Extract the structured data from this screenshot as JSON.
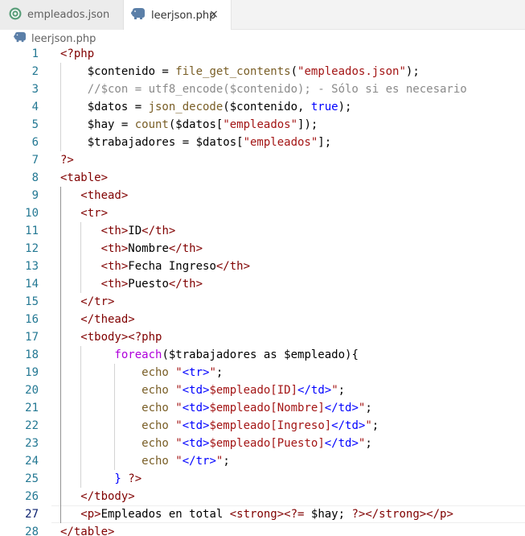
{
  "tabs": [
    {
      "label": "empleados.json",
      "icon": "json-file-icon",
      "active": false
    },
    {
      "label": "leerjson.php",
      "icon": "php-elephant-icon",
      "active": true,
      "close": "×"
    }
  ],
  "breadcrumb": {
    "label": "leerjson.php",
    "icon": "php-elephant-icon"
  },
  "editor": {
    "current_line": 27,
    "lines": [
      {
        "n": "1",
        "tokens": [
          [
            "t-php",
            "<?php"
          ]
        ]
      },
      {
        "n": "2",
        "tokens": [
          [
            "t-txt",
            "    $contenido = "
          ],
          [
            "t-fn",
            "file_get_contents"
          ],
          [
            "t-txt",
            "("
          ],
          [
            "t-str",
            "\"empleados.json\""
          ],
          [
            "t-txt",
            ");"
          ]
        ]
      },
      {
        "n": "3",
        "tokens": [
          [
            "t-cm",
            "    //$con = utf8_encode($contenido); - Sólo si es necesario"
          ]
        ]
      },
      {
        "n": "4",
        "tokens": [
          [
            "t-txt",
            "    $datos = "
          ],
          [
            "t-fn",
            "json_decode"
          ],
          [
            "t-txt",
            "($contenido, "
          ],
          [
            "t-kw",
            "true"
          ],
          [
            "t-txt",
            ");"
          ]
        ]
      },
      {
        "n": "5",
        "tokens": [
          [
            "t-txt",
            "    $hay = "
          ],
          [
            "t-fn",
            "count"
          ],
          [
            "t-txt",
            "($datos["
          ],
          [
            "t-str",
            "\"empleados\""
          ],
          [
            "t-txt",
            "]);"
          ]
        ]
      },
      {
        "n": "6",
        "tokens": [
          [
            "t-txt",
            "    $trabajadores = $datos["
          ],
          [
            "t-str",
            "\"empleados\""
          ],
          [
            "t-txt",
            "];"
          ]
        ]
      },
      {
        "n": "7",
        "tokens": [
          [
            "t-php",
            "?>"
          ]
        ]
      },
      {
        "n": "8",
        "tokens": [
          [
            "t-tag",
            "<table>"
          ]
        ]
      },
      {
        "n": "9",
        "tokens": [
          [
            "t-tag",
            "   <thead>"
          ]
        ]
      },
      {
        "n": "10",
        "tokens": [
          [
            "t-tag",
            "   <tr>"
          ]
        ]
      },
      {
        "n": "11",
        "tokens": [
          [
            "t-tag",
            "      <th>"
          ],
          [
            "t-txt",
            "ID"
          ],
          [
            "t-tag",
            "</th>"
          ]
        ]
      },
      {
        "n": "12",
        "tokens": [
          [
            "t-tag",
            "      <th>"
          ],
          [
            "t-txt",
            "Nombre"
          ],
          [
            "t-tag",
            "</th>"
          ]
        ]
      },
      {
        "n": "13",
        "tokens": [
          [
            "t-tag",
            "      <th>"
          ],
          [
            "t-txt",
            "Fecha Ingreso"
          ],
          [
            "t-tag",
            "</th>"
          ]
        ]
      },
      {
        "n": "14",
        "tokens": [
          [
            "t-tag",
            "      <th>"
          ],
          [
            "t-txt",
            "Puesto"
          ],
          [
            "t-tag",
            "</th>"
          ]
        ]
      },
      {
        "n": "15",
        "tokens": [
          [
            "t-tag",
            "   </tr>"
          ]
        ]
      },
      {
        "n": "16",
        "tokens": [
          [
            "t-tag",
            "   </thead>"
          ]
        ]
      },
      {
        "n": "17",
        "tokens": [
          [
            "t-tag",
            "   <tbody>"
          ],
          [
            "t-php",
            "<?php"
          ]
        ]
      },
      {
        "n": "18",
        "tokens": [
          [
            "t-ctl",
            "        foreach"
          ],
          [
            "t-txt",
            "($trabajadores as $empleado){"
          ]
        ]
      },
      {
        "n": "19",
        "tokens": [
          [
            "t-fn",
            "            echo "
          ],
          [
            "t-str",
            "\""
          ],
          [
            "t-str-b",
            "<tr>"
          ],
          [
            "t-str",
            "\""
          ],
          [
            "t-txt",
            ";"
          ]
        ]
      },
      {
        "n": "20",
        "tokens": [
          [
            "t-fn",
            "            echo "
          ],
          [
            "t-str",
            "\""
          ],
          [
            "t-str-b",
            "<td>"
          ],
          [
            "t-str",
            "$empleado[ID]"
          ],
          [
            "t-str-b",
            "</td>"
          ],
          [
            "t-str",
            "\""
          ],
          [
            "t-txt",
            ";"
          ]
        ]
      },
      {
        "n": "21",
        "tokens": [
          [
            "t-fn",
            "            echo "
          ],
          [
            "t-str",
            "\""
          ],
          [
            "t-str-b",
            "<td>"
          ],
          [
            "t-str",
            "$empleado[Nombre]"
          ],
          [
            "t-str-b",
            "</td>"
          ],
          [
            "t-str",
            "\""
          ],
          [
            "t-txt",
            ";"
          ]
        ]
      },
      {
        "n": "22",
        "tokens": [
          [
            "t-fn",
            "            echo "
          ],
          [
            "t-str",
            "\""
          ],
          [
            "t-str-b",
            "<td>"
          ],
          [
            "t-str",
            "$empleado[Ingreso]"
          ],
          [
            "t-str-b",
            "</td>"
          ],
          [
            "t-str",
            "\""
          ],
          [
            "t-txt",
            ";"
          ]
        ]
      },
      {
        "n": "23",
        "tokens": [
          [
            "t-fn",
            "            echo "
          ],
          [
            "t-str",
            "\""
          ],
          [
            "t-str-b",
            "<td>"
          ],
          [
            "t-str",
            "$empleado[Puesto]"
          ],
          [
            "t-str-b",
            "</td>"
          ],
          [
            "t-str",
            "\""
          ],
          [
            "t-txt",
            ";"
          ]
        ]
      },
      {
        "n": "24",
        "tokens": [
          [
            "t-fn",
            "            echo "
          ],
          [
            "t-str",
            "\""
          ],
          [
            "t-str-b",
            "</tr>"
          ],
          [
            "t-str",
            "\""
          ],
          [
            "t-txt",
            ";"
          ]
        ]
      },
      {
        "n": "25",
        "tokens": [
          [
            "t-kw",
            "        } "
          ],
          [
            "t-php",
            "?>"
          ]
        ]
      },
      {
        "n": "26",
        "tokens": [
          [
            "t-tag",
            "   </tbody>"
          ]
        ]
      },
      {
        "n": "27",
        "tokens": [
          [
            "t-tag",
            "   <p>"
          ],
          [
            "t-txt",
            "Empleados en total "
          ],
          [
            "t-tag",
            "<strong>"
          ],
          [
            "t-php",
            "<?= "
          ],
          [
            "t-txt",
            "$hay; "
          ],
          [
            "t-php",
            "?>"
          ],
          [
            "t-tag",
            "</strong></p>"
          ]
        ]
      },
      {
        "n": "28",
        "tokens": [
          [
            "t-tag",
            "</table>"
          ]
        ]
      }
    ]
  },
  "colors": {
    "line_number": "#237893",
    "active_line_number": "#0b216f",
    "php_delimiter": "#800000",
    "function": "#795e26",
    "string": "#a31515",
    "comment": "#8a8a8a",
    "keyword": "#0000ff"
  }
}
